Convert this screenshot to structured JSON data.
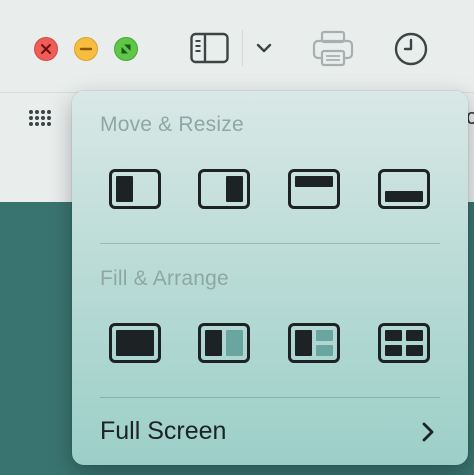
{
  "window": {
    "controls": {
      "close": {
        "icon": "close-icon",
        "color": "#ee5d58"
      },
      "minimize": {
        "icon": "minimize-icon",
        "color": "#f6bd3f"
      },
      "zoom": {
        "icon": "zoom-icon",
        "color": "#5fc649"
      }
    },
    "toolbar": {
      "icons": [
        "sidebar-icon",
        "chevron-down-icon",
        "printer-icon",
        "clock-icon",
        "grid-icon"
      ],
      "edge_text": "c"
    }
  },
  "popover": {
    "sections": [
      {
        "title": "Move & Resize",
        "layouts": [
          "left-half-layout-icon",
          "right-half-layout-icon",
          "top-half-layout-icon",
          "bottom-half-layout-icon"
        ]
      },
      {
        "title": "Fill & Arrange",
        "layouts": [
          "fill-layout-icon",
          "split-two-layout-icon",
          "split-three-layout-icon",
          "quadrant-layout-icon"
        ]
      }
    ],
    "full_screen": {
      "label": "Full Screen",
      "icon": "chevron-right-icon"
    }
  },
  "colors": {
    "desktop": "#3a7470",
    "chrome": "#e9eeed",
    "icon_dark": "#1d2224",
    "pane_light": "#6aa69f"
  }
}
